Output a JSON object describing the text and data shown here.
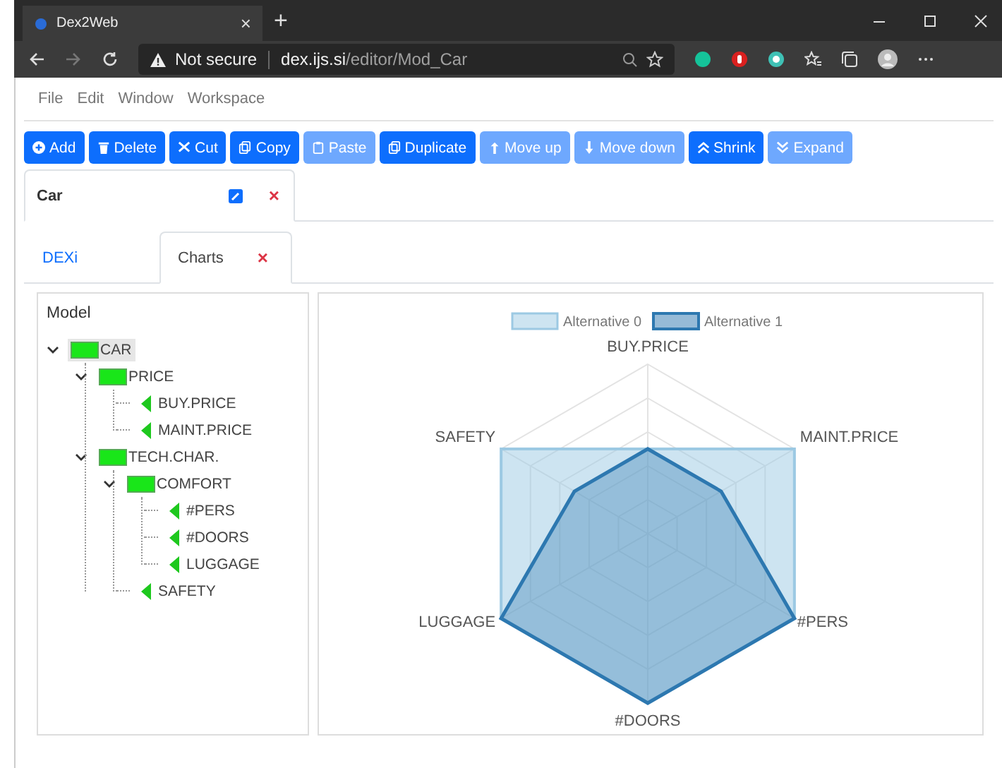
{
  "browser": {
    "tab_title": "Dex2Web",
    "tab_close": "×",
    "new_tab": "+",
    "security": "Not secure",
    "url_host": "dex.ijs.si",
    "url_path": "/editor/Mod_Car"
  },
  "menu": [
    "File",
    "Edit",
    "Window",
    "Workspace"
  ],
  "toolbar": [
    {
      "label": "Add",
      "disabled": false
    },
    {
      "label": "Delete",
      "disabled": false
    },
    {
      "label": "Cut",
      "disabled": false
    },
    {
      "label": "Copy",
      "disabled": false
    },
    {
      "label": "Paste",
      "disabled": true
    },
    {
      "label": "Duplicate",
      "disabled": false
    },
    {
      "label": "Move up",
      "disabled": true
    },
    {
      "label": "Move down",
      "disabled": true
    },
    {
      "label": "Shrink",
      "disabled": false
    },
    {
      "label": "Expand",
      "disabled": true
    }
  ],
  "document_tab": {
    "title": "Car",
    "close": "×"
  },
  "view_tabs": [
    {
      "label": "DEXi",
      "selected": false
    },
    {
      "label": "Charts",
      "selected": true,
      "close": "×"
    }
  ],
  "model": {
    "title": "Model",
    "tree": [
      {
        "label": "CAR",
        "kind": "aggregate",
        "expanded": true,
        "selected": true,
        "children": [
          {
            "label": "PRICE",
            "kind": "aggregate",
            "expanded": true,
            "selected": false,
            "children": [
              {
                "label": "BUY.PRICE",
                "kind": "basic",
                "selected": false
              },
              {
                "label": "MAINT.PRICE",
                "kind": "basic",
                "selected": false
              }
            ]
          },
          {
            "label": "TECH.CHAR.",
            "kind": "aggregate",
            "expanded": true,
            "selected": false,
            "children": [
              {
                "label": "COMFORT",
                "kind": "aggregate",
                "expanded": true,
                "selected": false,
                "children": [
                  {
                    "label": "#PERS",
                    "kind": "basic",
                    "selected": false
                  },
                  {
                    "label": "#DOORS",
                    "kind": "basic",
                    "selected": false
                  },
                  {
                    "label": "LUGGAGE",
                    "kind": "basic",
                    "selected": false
                  }
                ]
              },
              {
                "label": "SAFETY",
                "kind": "basic",
                "selected": false
              }
            ]
          }
        ]
      }
    ]
  },
  "chart": {
    "legend": [
      {
        "name": "Alternative 0",
        "color": "#9cc9e3"
      },
      {
        "name": "Alternative 1",
        "color": "#2d78b0"
      }
    ],
    "axes": [
      "BUY.PRICE",
      "MAINT.PRICE",
      "#PERS",
      "#DOORS",
      "LUGGAGE",
      "SAFETY"
    ]
  }
}
